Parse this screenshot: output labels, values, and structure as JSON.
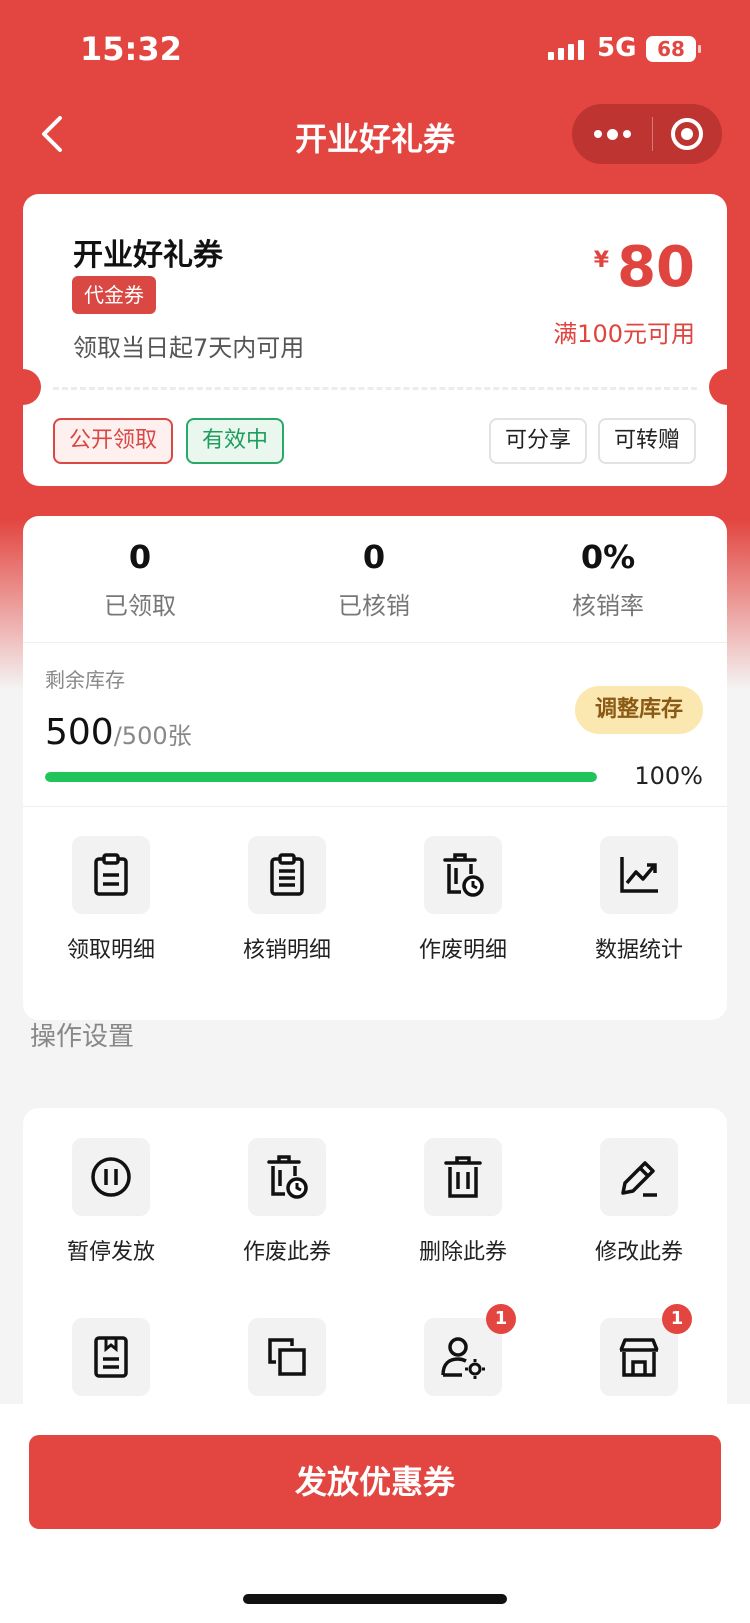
{
  "status_bar": {
    "time": "15:32",
    "network": "5G",
    "battery": "68"
  },
  "nav": {
    "title": "开业好礼券"
  },
  "coupon": {
    "name": "开业好礼券",
    "type": "代金券",
    "validity": "领取当日起7天内可用",
    "currency": "¥",
    "amount": "80",
    "condition": "满100元可用",
    "tags": {
      "public": "公开领取",
      "status": "有效中"
    },
    "actions": {
      "share": "可分享",
      "gift": "可转赠"
    }
  },
  "stats": {
    "received": {
      "value": "0",
      "label": "已领取"
    },
    "redeemed": {
      "value": "0",
      "label": "已核销"
    },
    "rate": {
      "value": "0%",
      "label": "核销率"
    }
  },
  "stock": {
    "label": "剩余库存",
    "remaining": "500",
    "total": "/500张",
    "adjust_label": "调整库存",
    "percent_text": "100%",
    "fill_fraction": 1.0,
    "bar_color": "#1fc45b"
  },
  "detail_links": [
    {
      "label": "领取明细",
      "icon": "clipboard-icon"
    },
    {
      "label": "核销明细",
      "icon": "document-list-icon"
    },
    {
      "label": "作废明细",
      "icon": "trash-clock-icon"
    },
    {
      "label": "数据统计",
      "icon": "chart-trend-icon"
    }
  ],
  "ops_section": {
    "title": "操作设置"
  },
  "operations": [
    {
      "label": "暂停发放",
      "icon": "pause-circle-icon"
    },
    {
      "label": "作废此券",
      "icon": "trash-clock-icon"
    },
    {
      "label": "删除此券",
      "icon": "trash-icon"
    },
    {
      "label": "修改此券",
      "icon": "pencil-icon"
    }
  ],
  "operations_row2": [
    {
      "icon": "bookmark-document-icon",
      "badge": ""
    },
    {
      "icon": "copy-squares-icon",
      "badge": ""
    },
    {
      "icon": "user-settings-icon",
      "badge": "1"
    },
    {
      "icon": "store-icon",
      "badge": "1"
    }
  ],
  "footer": {
    "issue_button": "发放优惠券"
  },
  "colors": {
    "brand_red": "#e34641",
    "active_green": "#1f9d5c",
    "stock_bar": "#1fc45b",
    "adjust_bg": "#fbe8b0"
  }
}
